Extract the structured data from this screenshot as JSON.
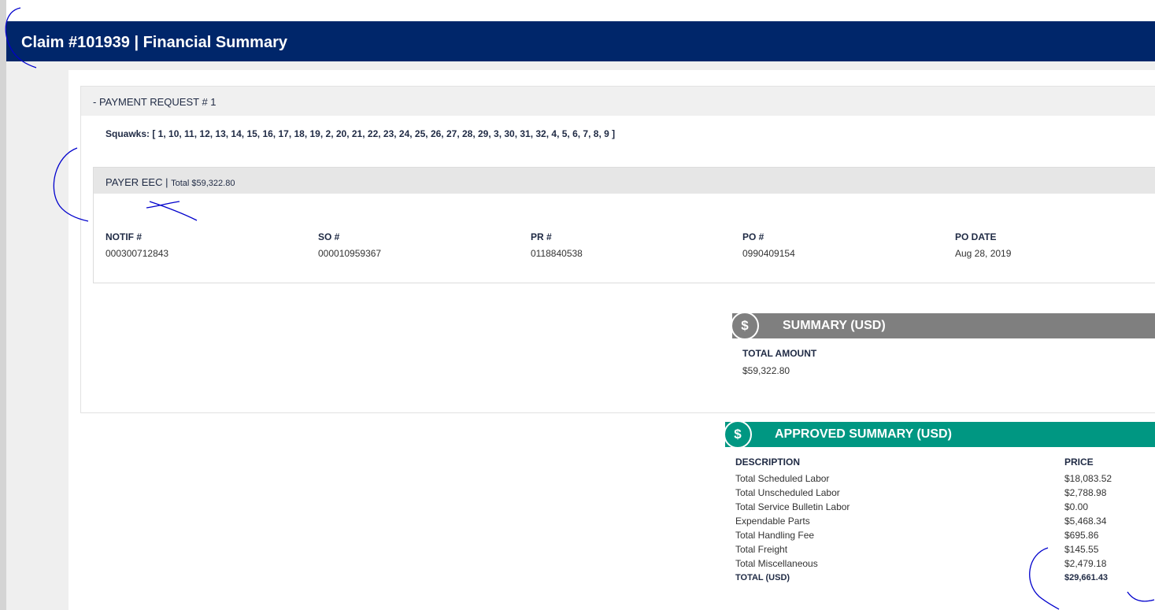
{
  "header": {
    "title": "Claim #101939 | Financial Summary"
  },
  "payment_request": {
    "heading": "- PAYMENT REQUEST # 1",
    "squawks": "Squawks: [ 1, 10, 11, 12, 13, 14, 15, 16, 17, 18, 19, 2, 20, 21, 22, 23, 24, 25, 26, 27, 28, 29, 3, 30, 31, 32, 4, 5, 6, 7, 8, 9 ]",
    "payer": {
      "name": "PAYER EEC | ",
      "total": "Total $59,322.80",
      "fields": [
        {
          "label": "NOTIF #",
          "value": "000300712843"
        },
        {
          "label": "SO #",
          "value": "000010959367"
        },
        {
          "label": "PR #",
          "value": "0118840538"
        },
        {
          "label": "PO #",
          "value": "0990409154"
        },
        {
          "label": "PO DATE",
          "value": "Aug 28, 2019"
        }
      ]
    }
  },
  "summary": {
    "icon": "dollar-icon",
    "icon_glyph": "$",
    "title": "SUMMARY (USD)",
    "total_label": "TOTAL AMOUNT",
    "total_value": "$59,322.80",
    "color": "#7f7f7f"
  },
  "approved": {
    "icon": "dollar-icon",
    "icon_glyph": "$",
    "title": "APPROVED SUMMARY (USD)",
    "color": "#009782",
    "col_desc": "DESCRIPTION",
    "col_price": "PRICE",
    "rows": [
      {
        "desc": "Total Scheduled Labor",
        "price": "$18,083.52"
      },
      {
        "desc": "Total Unscheduled Labor",
        "price": "$2,788.98"
      },
      {
        "desc": "Total Service Bulletin Labor",
        "price": "$0.00"
      },
      {
        "desc": "Expendable Parts",
        "price": "$5,468.34"
      },
      {
        "desc": "Total Handling Fee",
        "price": "$695.86"
      },
      {
        "desc": "Total Freight",
        "price": "$145.55"
      },
      {
        "desc": "Total Miscellaneous",
        "price": "$2,479.18"
      }
    ],
    "total": {
      "desc": "TOTAL (USD)",
      "price": "$29,661.43"
    }
  },
  "colors": {
    "header_bg": "#00266a",
    "annotation_ink": "#0000cc"
  }
}
